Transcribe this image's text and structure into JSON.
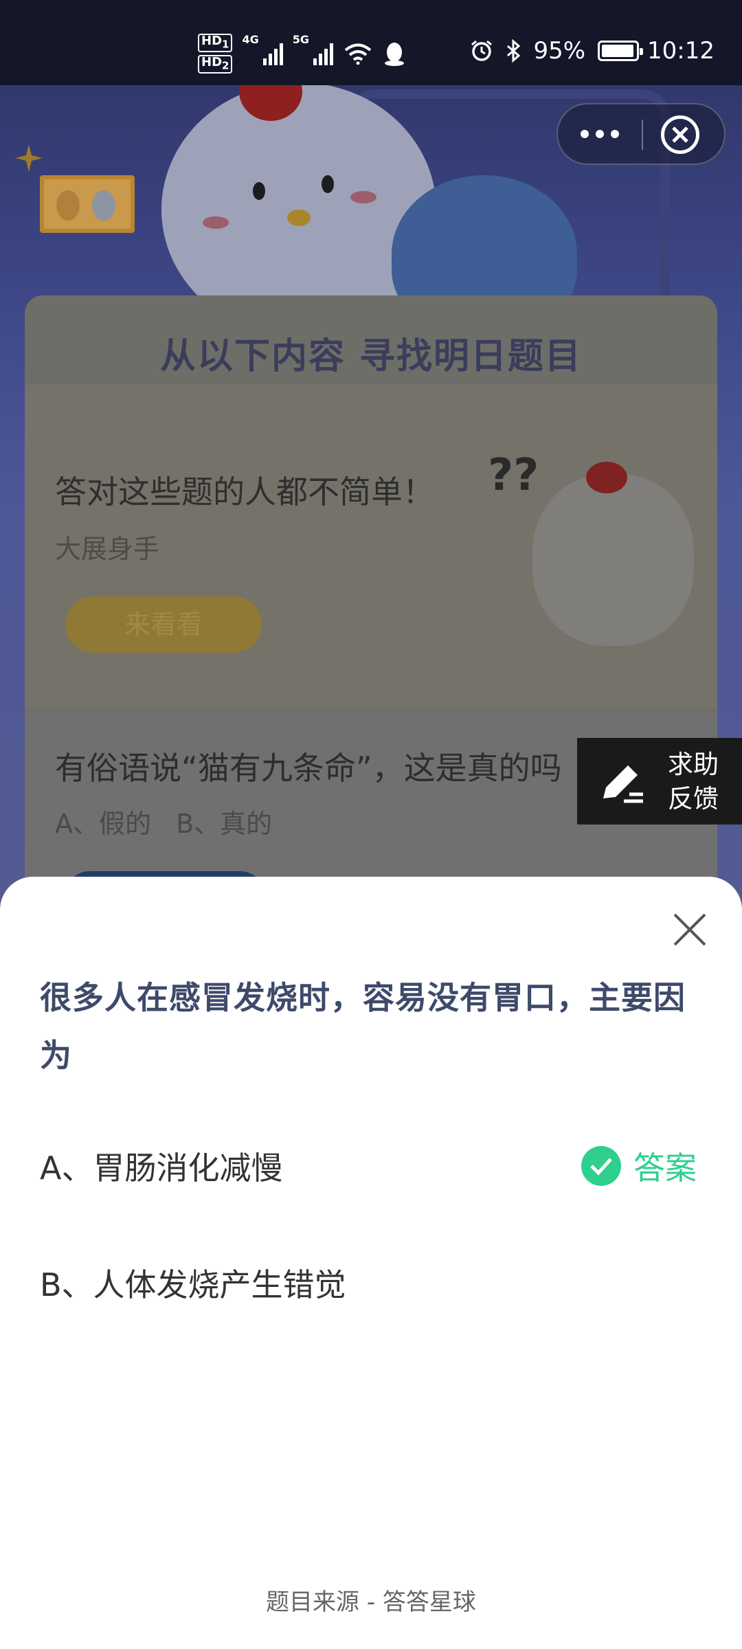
{
  "status_bar": {
    "hd1": "HD",
    "hd1_sub": "1",
    "hd2": "HD",
    "hd2_sub": "2",
    "net1": "4G",
    "net2": "5G",
    "battery_percent_text": "95%",
    "battery_level": 0.95,
    "time": "10:12"
  },
  "background": {
    "card_title": "从以下内容  寻找明日题目",
    "card1": {
      "title": "答对这些题的人都不简单！",
      "subtitle": "大展身手",
      "button": "来看看"
    },
    "card2": {
      "title": "有俗语说“猫有九条命”，这是真的吗",
      "options": "A、假的    B、真的"
    },
    "question_marks": "??"
  },
  "feedback": {
    "line1": "求助",
    "line2": "反馈"
  },
  "sheet": {
    "question": "很多人在感冒发烧时，容易没有胃口，主要因为",
    "option_a": "A、胃肠消化减慢",
    "option_b": "B、人体发烧产生错觉",
    "answer_label": "答案",
    "answer_color": "#2fcf8e",
    "source": "题目来源 - 答答星球"
  },
  "icons": [
    "wifi-icon",
    "qq-icon",
    "alarm-icon",
    "bluetooth-icon",
    "battery-icon",
    "more-icon",
    "close-circle-icon",
    "pen-icon",
    "close-icon",
    "check-icon"
  ]
}
